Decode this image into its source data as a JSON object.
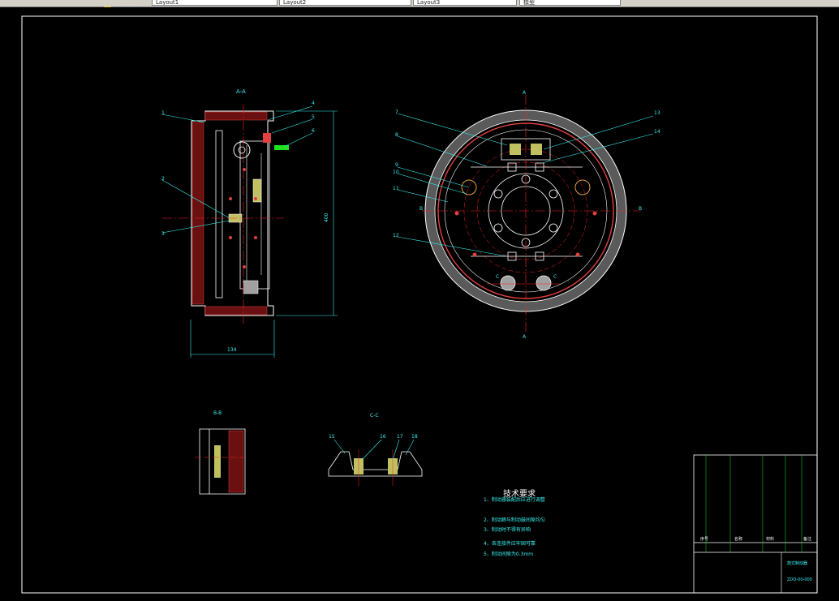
{
  "toolbar": {
    "tabs": [
      "Layout1",
      "Layout2",
      "Layout3",
      "模型"
    ]
  },
  "drawing": {
    "view_labels": {
      "section_a": "A-A",
      "section_b": "B-B",
      "section_c": "C-C",
      "mark_a_top": "A",
      "mark_a_bottom": "A",
      "mark_b_left": "B",
      "mark_b_right": "B",
      "mark_c_left": "C",
      "mark_c_right": "C"
    },
    "dimensions": {
      "width": "134",
      "height": "400"
    },
    "callouts_left": [
      "1",
      "2",
      "3",
      "4",
      "5",
      "6"
    ],
    "callouts_right": [
      "7",
      "8",
      "9",
      "10",
      "11",
      "12",
      "13",
      "14"
    ],
    "callouts_cc": [
      "15",
      "16",
      "17",
      "18"
    ],
    "tech_requirements": {
      "title": "技术要求",
      "items": [
        "1、制动器装配后应进行调整",
        "2、制动蹄与制动鼓间隙均匀",
        "3、制动时不得有异响",
        "4、各连接件应牢固可靠",
        "5、制动间隙为0.3mm"
      ]
    },
    "title_block": {
      "col_headers": [
        "序号",
        "名称",
        "材料",
        "备注"
      ],
      "drawing_title": "鼓式制动器",
      "drawing_no": "ZDQ-00-000"
    }
  },
  "colors": {
    "canvas": "#000000",
    "outline": "#ffffff",
    "dimension": "#38f0f0",
    "centerline": "#ff2020",
    "hatch": "#e04040",
    "part_green": "#20e020",
    "gray_fill": "#a0a0a0"
  }
}
